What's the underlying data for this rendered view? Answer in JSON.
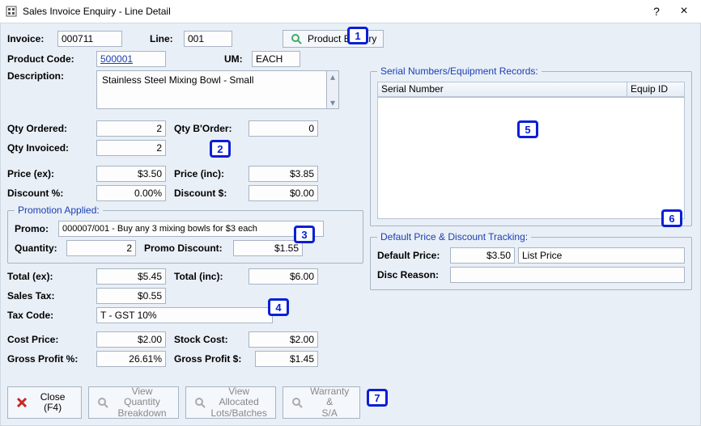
{
  "window": {
    "title": "Sales Invoice Enquiry - Line Detail",
    "help_tooltip": "?",
    "close_tooltip": "×"
  },
  "top": {
    "invoice_label": "Invoice:",
    "invoice": "000711",
    "line_label": "Line:",
    "line": "001",
    "product_enquiry_label": "Product Enquiry"
  },
  "product": {
    "code_label": "Product Code:",
    "code": "500001",
    "um_label": "UM:",
    "um": "EACH",
    "desc_label": "Description:",
    "description": "Stainless Steel Mixing Bowl - Small"
  },
  "qty": {
    "ordered_label": "Qty Ordered:",
    "ordered": "2",
    "border_label": "Qty B'Order:",
    "border": "0",
    "invoiced_label": "Qty Invoiced:",
    "invoiced": "2"
  },
  "price": {
    "ex_label": "Price (ex):",
    "ex": "$3.50",
    "inc_label": "Price (inc):",
    "inc": "$3.85",
    "disc_pct_label": "Discount %:",
    "disc_pct": "0.00%",
    "disc_amt_label": "Discount $:",
    "disc_amt": "$0.00"
  },
  "promo": {
    "legend": "Promotion Applied:",
    "promo_label": "Promo:",
    "promo": "000007/001 - Buy any 3 mixing bowls for $3 each",
    "qty_label": "Quantity:",
    "qty": "2",
    "disc_label": "Promo Discount:",
    "disc": "$1.55"
  },
  "totals": {
    "ex_label": "Total (ex):",
    "ex": "$5.45",
    "inc_label": "Total (inc):",
    "inc": "$6.00",
    "tax_label": "Sales Tax:",
    "tax": "$0.55",
    "taxcode_label": "Tax Code:",
    "taxcode": "T - GST 10%",
    "cost_label": "Cost Price:",
    "cost": "$2.00",
    "stock_label": "Stock Cost:",
    "stock": "$2.00",
    "gp_pct_label": "Gross Profit %:",
    "gp_pct": "26.61%",
    "gp_amt_label": "Gross Profit $:",
    "gp_amt": "$1.45"
  },
  "serial": {
    "legend": "Serial Numbers/Equipment Records:",
    "col_serial": "Serial Number",
    "col_equip": "Equip ID"
  },
  "default_price": {
    "legend": "Default Price & Discount Tracking:",
    "price_label": "Default Price:",
    "price": "$3.50",
    "price_type": "List Price",
    "reason_label": "Disc Reason:",
    "reason": ""
  },
  "toolbar": {
    "close": "Close (F4)",
    "qty_breakdown_l1": "View Quantity",
    "qty_breakdown_l2": "Breakdown",
    "lots_l1": "View Allocated",
    "lots_l2": "Lots/Batches",
    "warranty_l1": "Warranty &",
    "warranty_l2": "S/A"
  },
  "callouts": [
    "1",
    "2",
    "3",
    "4",
    "5",
    "6",
    "7"
  ]
}
